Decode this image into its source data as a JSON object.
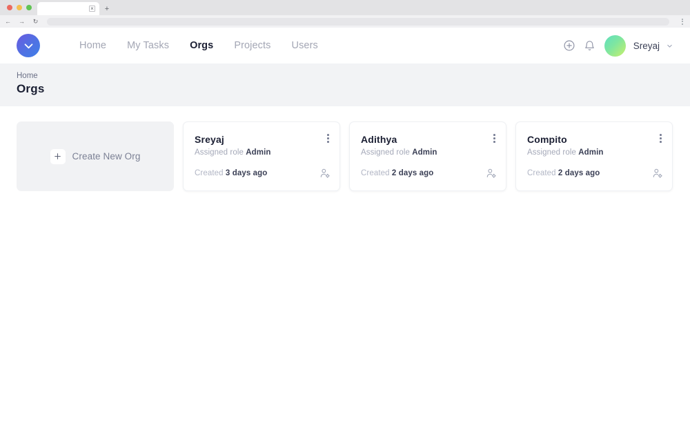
{
  "browser": {
    "tab_title": "",
    "tab_close_label": "×",
    "new_tab_label": "+",
    "back_icon": "←",
    "forward_icon": "→",
    "reload_icon": "↻",
    "url_value": "",
    "url_placeholder": ""
  },
  "header": {
    "logo_name": "check-circle-logo",
    "nav": [
      {
        "label": "Home",
        "active": false
      },
      {
        "label": "My Tasks",
        "active": false
      },
      {
        "label": "Orgs",
        "active": true
      },
      {
        "label": "Projects",
        "active": false
      },
      {
        "label": "Users",
        "active": false
      }
    ],
    "add_icon": "plus-circle-icon",
    "notifications_icon": "bell-icon",
    "user_name": "Sreyaj",
    "caret_icon": "chevron-down-icon"
  },
  "page": {
    "breadcrumb": "Home",
    "title": "Orgs"
  },
  "create_card": {
    "label": "Create New Org",
    "plus_icon": "plus-icon"
  },
  "labels": {
    "role_prefix": "Assigned role",
    "created_prefix": "Created",
    "kebab_icon": "kebab-menu-icon",
    "members_icon": "manage-members-icon"
  },
  "orgs": [
    {
      "name": "Sreyaj",
      "role": "Admin",
      "created": "3 days ago"
    },
    {
      "name": "Adithya",
      "role": "Admin",
      "created": "2 days ago"
    },
    {
      "name": "Compito",
      "role": "Admin",
      "created": "2 days ago"
    }
  ],
  "colors": {
    "accent": "#4f72e3",
    "band_bg": "#f2f3f5",
    "text_dark": "#1b1f33",
    "text_muted": "#a4a8b8"
  }
}
